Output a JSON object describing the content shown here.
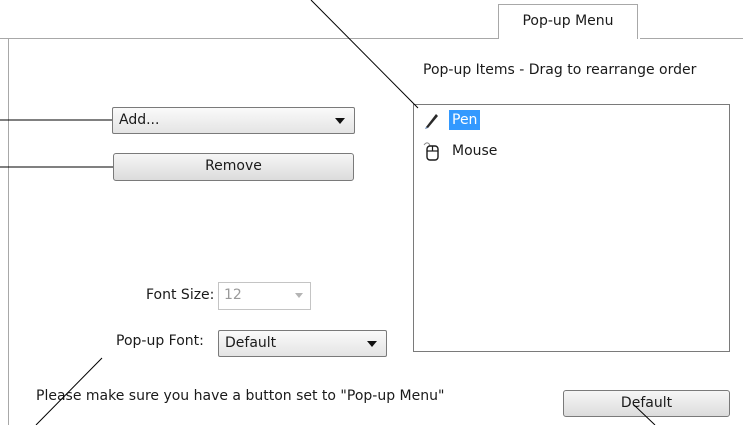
{
  "tab": {
    "label": "Pop-up Menu"
  },
  "popup_items": {
    "heading": "Pop-up Items - Drag to rearrange order",
    "items": [
      {
        "label": "Pen",
        "icon": "pen-icon",
        "selected": true
      },
      {
        "label": "Mouse",
        "icon": "mouse-icon",
        "selected": false
      }
    ]
  },
  "add_select": {
    "value": "Add..."
  },
  "remove_button": {
    "label": "Remove"
  },
  "font_size": {
    "label": "Font Size:",
    "value": "12",
    "enabled": false
  },
  "popup_font": {
    "label": "Pop-up Font:",
    "value": "Default"
  },
  "notice": "Please make sure you have a button set to \"Pop-up Menu\"",
  "default_button": {
    "label": "Default"
  },
  "colors": {
    "selection": "#3399ff",
    "border": "#7a7a7a",
    "frame": "#a8a8a8"
  }
}
